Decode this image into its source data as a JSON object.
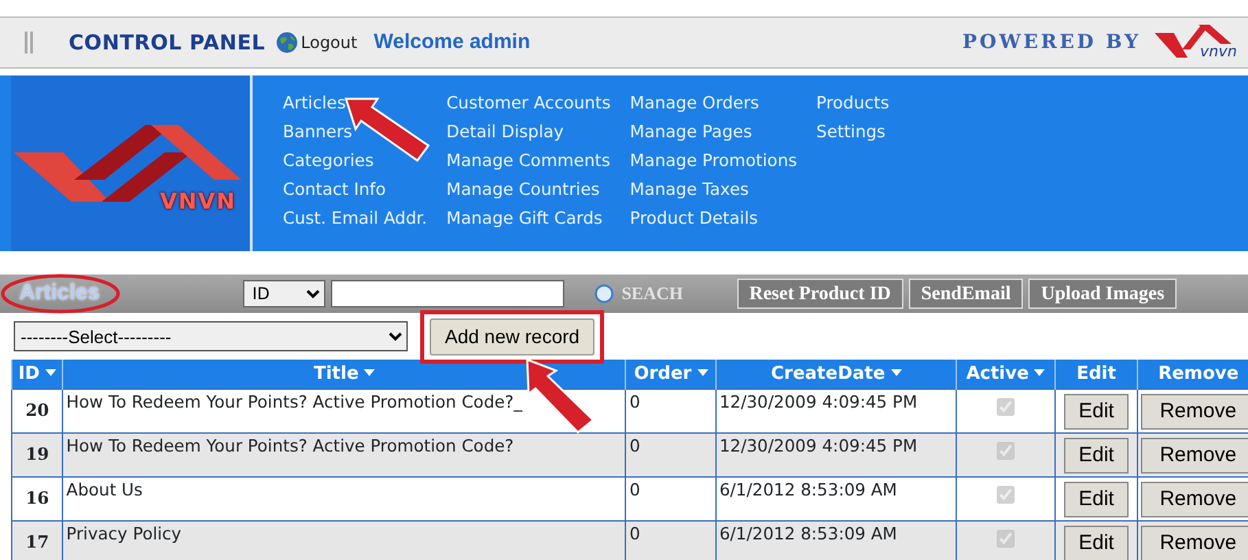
{
  "header": {
    "title": "CONTROL PANEL",
    "logout": "Logout",
    "welcome": "Welcome admin",
    "powered_by": "POWERED BY",
    "brand_mark": "vnvn"
  },
  "logo": {
    "text": "VNVN"
  },
  "menu": [
    [
      "Articles",
      "Banners",
      "Categories",
      "Contact Info",
      "Cust. Email Addr."
    ],
    [
      "Customer Accounts",
      "Detail Display",
      "Manage Comments",
      "Manage Countries",
      "Manage Gift Cards"
    ],
    [
      "Manage Orders",
      "Manage Pages",
      "Manage Promotions",
      "Manage Taxes",
      "Product Details"
    ],
    [
      "Products",
      "Settings"
    ]
  ],
  "toolbar": {
    "section_title": "Articles",
    "filter_field": "ID",
    "search_label": "SEACH",
    "buttons": [
      "Reset Product ID",
      "SendEmail",
      "Upload Images"
    ]
  },
  "select": {
    "value": "--------Select---------"
  },
  "add_button": "Add new record",
  "table": {
    "columns": [
      {
        "label": "ID",
        "sortable": true
      },
      {
        "label": "Title",
        "sortable": true
      },
      {
        "label": "Order",
        "sortable": true
      },
      {
        "label": "CreateDate",
        "sortable": true
      },
      {
        "label": "Active",
        "sortable": true
      },
      {
        "label": "Edit",
        "sortable": false
      },
      {
        "label": "Remove",
        "sortable": false
      }
    ],
    "rows": [
      {
        "id": "20",
        "title": "How To Redeem Your Points? Active Promotion Code?_",
        "order": "0",
        "create_date": "12/30/2009 4:09:45 PM",
        "active": true,
        "edit": "Edit",
        "remove": "Remove"
      },
      {
        "id": "19",
        "title": "How To Redeem Your Points? Active Promotion Code?",
        "order": "0",
        "create_date": "12/30/2009 4:09:45 PM",
        "active": true,
        "edit": "Edit",
        "remove": "Remove"
      },
      {
        "id": "16",
        "title": "About Us",
        "order": "0",
        "create_date": "6/1/2012 8:53:09 AM",
        "active": true,
        "edit": "Edit",
        "remove": "Remove"
      },
      {
        "id": "17",
        "title": "Privacy Policy",
        "order": "0",
        "create_date": "6/1/2012 8:53:09 AM",
        "active": true,
        "edit": "Edit",
        "remove": "Remove"
      }
    ]
  }
}
